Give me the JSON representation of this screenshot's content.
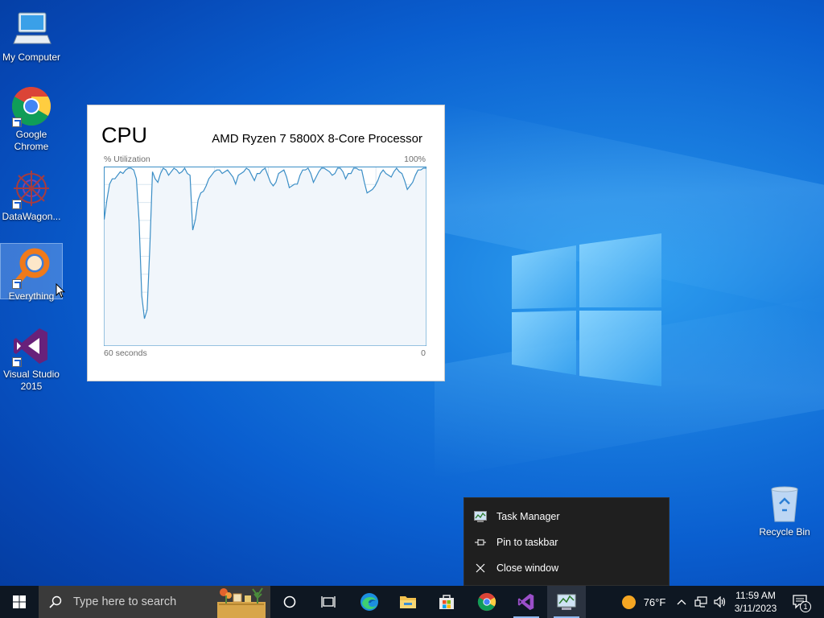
{
  "desktop": {
    "icons": [
      {
        "label": "My Computer",
        "icon": "computer-icon"
      },
      {
        "label": "Google Chrome",
        "icon": "chrome-icon"
      },
      {
        "label": "DataWagon...",
        "icon": "datawagon-icon"
      },
      {
        "label": "Everything",
        "icon": "everything-icon"
      },
      {
        "label": "Visual Studio 2015",
        "icon": "visual-studio-icon"
      }
    ],
    "recycle_bin": {
      "label": "Recycle Bin",
      "icon": "recycle-bin-icon"
    }
  },
  "cpu_widget": {
    "title": "CPU",
    "processor": "AMD Ryzen 7 5800X 8-Core Processor",
    "y_label": "% Utilization",
    "y_max_label": "100%",
    "x_left_label": "60 seconds",
    "x_right_label": "0",
    "line_color": "#3b8ec6",
    "fill_color": "#f1f6fb",
    "grid_color": "#d9e6f0"
  },
  "chart_data": {
    "type": "area",
    "xlabel": "60 seconds",
    "ylabel": "% Utilization",
    "ylim": [
      0,
      100
    ],
    "xlim": [
      60,
      0
    ],
    "x": [
      60,
      59.5,
      59,
      58.5,
      58,
      57.5,
      57,
      56.5,
      56,
      55.5,
      55,
      54.5,
      54,
      53.5,
      53,
      52.5,
      52,
      51.5,
      51,
      50.5,
      50,
      49.5,
      49,
      48.5,
      48,
      47.5,
      47,
      46.5,
      46,
      45.5,
      45,
      44.5,
      44,
      43.5,
      43,
      42.5,
      42,
      41.5,
      41,
      40.5,
      40,
      39.5,
      39,
      38.5,
      38,
      37.5,
      37,
      36.5,
      36,
      35.5,
      35,
      34.5,
      34,
      33.5,
      33,
      32.5,
      32,
      31.5,
      31,
      30.5,
      30,
      29.5,
      29,
      28.5,
      28,
      27.5,
      27,
      26.5,
      26,
      25.5,
      25,
      24.5,
      24,
      23.5,
      23,
      22.5,
      22,
      21.5,
      21,
      20.5,
      20,
      19.5,
      19,
      18.5,
      18,
      17.5,
      17,
      16.5,
      16,
      15.5,
      15,
      14.5,
      14,
      13.5,
      13,
      12.5,
      12,
      11.5,
      11,
      10.5,
      10,
      9.5,
      9,
      8.5,
      8,
      7.5,
      7,
      6.5,
      6,
      5.5,
      5,
      4.5,
      4,
      3.5,
      3,
      2.5,
      2,
      1.5,
      1,
      0.5,
      0
    ],
    "series": [
      {
        "values": [
          71,
          82,
          91,
          94,
          94,
          96,
          98,
          97,
          99,
          100,
          100,
          99,
          94,
          70,
          28,
          15,
          20,
          55,
          98,
          94,
          92,
          97,
          100,
          99,
          96,
          98,
          100,
          99,
          97,
          98,
          100,
          97,
          96,
          65,
          71,
          82,
          86,
          87,
          90,
          94,
          96,
          98,
          99,
          99,
          97,
          98,
          99,
          97,
          95,
          91,
          96,
          97,
          98,
          100,
          99,
          96,
          93,
          97,
          97,
          99,
          100,
          96,
          92,
          90,
          92,
          97,
          98,
          99,
          95,
          89,
          90,
          91,
          91,
          96,
          99,
          99,
          100,
          97,
          92,
          95,
          98,
          100,
          100,
          99,
          98,
          96,
          97,
          100,
          100,
          98,
          94,
          97,
          97,
          100,
          100,
          99,
          99,
          92,
          86,
          87,
          88,
          90,
          93,
          97,
          99,
          97,
          96,
          95,
          98,
          100,
          98,
          97,
          93,
          88,
          90,
          92,
          96,
          99,
          99,
          100,
          100
        ]
      }
    ]
  },
  "context_menu": {
    "items": [
      {
        "label": "Task Manager",
        "icon": "task-manager-icon"
      },
      {
        "label": "Pin to taskbar",
        "icon": "pin-icon"
      },
      {
        "label": "Close window",
        "icon": "close-icon"
      }
    ]
  },
  "taskbar": {
    "search_placeholder": "Type here to search",
    "weather_temp": "76°F",
    "time": "11:59 AM",
    "date": "3/11/2023",
    "notification_count": "1",
    "apps": [
      "cortana-icon",
      "task-view-icon",
      "edge-icon",
      "file-explorer-icon",
      "microsoft-store-icon",
      "chrome-icon",
      "visual-studio-icon",
      "task-manager-icon"
    ]
  }
}
